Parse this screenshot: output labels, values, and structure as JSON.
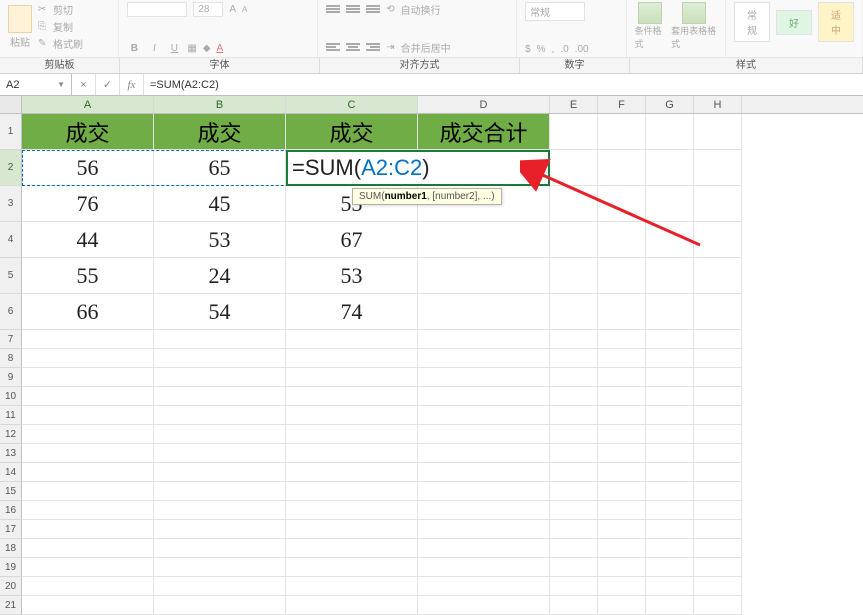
{
  "ribbon": {
    "clipboard": {
      "paste": "粘贴",
      "cut": "剪切",
      "copy": "复制",
      "format_painter": "格式刷",
      "label": "剪贴板"
    },
    "font": {
      "size": "28",
      "b": "B",
      "i": "I",
      "u": "U",
      "label": "字体"
    },
    "alignment": {
      "wrap": "自动换行",
      "merge": "合并后居中",
      "label": "对齐方式"
    },
    "number": {
      "general": "常规",
      "label": "数字"
    },
    "styles": {
      "conditional": "条件格式",
      "format_table": "套用表格格式",
      "normal": "常规",
      "good": "好",
      "suitable": "适中",
      "label": "样式"
    }
  },
  "formula_bar": {
    "name_box": "A2",
    "cancel": "×",
    "enter": "✓",
    "fx": "fx",
    "formula": "=SUM(A2:C2)"
  },
  "columns": [
    "A",
    "B",
    "C",
    "D",
    "E",
    "F",
    "G",
    "H"
  ],
  "header_row": [
    "成交",
    "成交",
    "成交",
    "成交合计"
  ],
  "chart_data": {
    "type": "table",
    "title": "",
    "columns": [
      "成交",
      "成交",
      "成交",
      "成交合计"
    ],
    "rows": [
      {
        "A": 56,
        "B": 65,
        "C_display": "=SUM(A2:C2)",
        "C_formula_ref": "A2:C2",
        "D": ""
      },
      {
        "A": 76,
        "B": 45,
        "C": 53,
        "D": ""
      },
      {
        "A": 44,
        "B": 53,
        "C": 67,
        "D": ""
      },
      {
        "A": 55,
        "B": 24,
        "C": 53,
        "D": ""
      },
      {
        "A": 66,
        "B": 54,
        "C": 74,
        "D": ""
      }
    ]
  },
  "tooltip": {
    "prefix": "SUM(",
    "bold": "number1",
    "rest": ", [number2], ...)"
  },
  "row_nums": [
    1,
    2,
    3,
    4,
    5,
    6,
    7,
    8,
    9,
    10,
    11,
    12,
    13,
    14,
    15,
    16,
    17,
    18,
    19,
    20,
    21
  ]
}
